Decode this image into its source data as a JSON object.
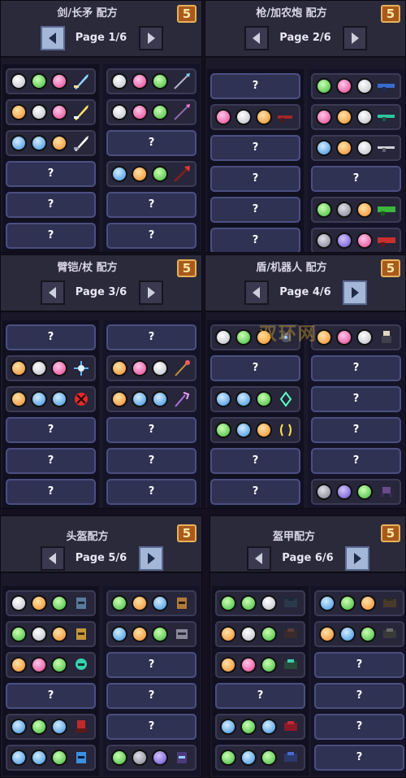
{
  "badge": "5",
  "empty_mark": "?",
  "watermark": "双环网",
  "panels": [
    {
      "title": "剑/长矛 配方",
      "page": "Page 1/6"
    },
    {
      "title": "枪/加农炮 配方",
      "page": "Page 2/6"
    },
    {
      "title": "臂铠/杖 配方",
      "page": "Page 3/6"
    },
    {
      "title": "盾/机器人 配方",
      "page": "Page 4/6"
    },
    {
      "title": "头盔配方",
      "page": "Page 5/6"
    },
    {
      "title": "盔甲配方",
      "page": "Page 6/6"
    }
  ],
  "colors": {
    "white": "#ffffff",
    "green": "#3fb63c",
    "pink": "#e2418f",
    "orange": "#f08a2a",
    "blue": "#3a8fe0",
    "gray": "#7d7d8f",
    "purple": "#6a4fc9"
  },
  "item_icons": [
    "sword-icon",
    "spear-icon",
    "gun-icon",
    "cannon-icon",
    "gauntlet-icon",
    "staff-icon",
    "shield-icon",
    "robot-icon",
    "helmet-icon",
    "armor-icon"
  ]
}
